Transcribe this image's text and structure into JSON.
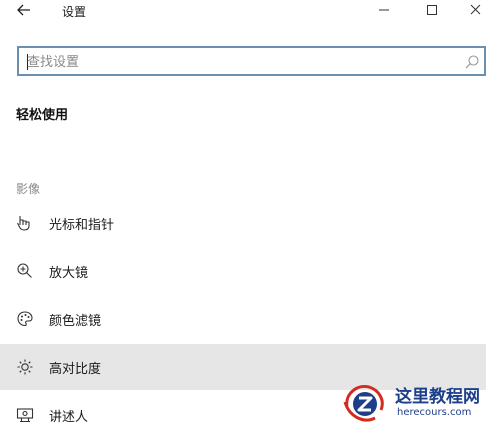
{
  "window": {
    "title": "设置"
  },
  "search": {
    "placeholder": "查找设置",
    "value": ""
  },
  "section": {
    "title": "轻松使用"
  },
  "group": {
    "label": "影像"
  },
  "nav_items": [
    {
      "label": "光标和指针",
      "icon": "pointer-hand-icon"
    },
    {
      "label": "放大镜",
      "icon": "magnifier-icon"
    },
    {
      "label": "颜色滤镜",
      "icon": "color-palette-icon"
    },
    {
      "label": "高对比度",
      "icon": "brightness-icon",
      "selected": true
    },
    {
      "label": "讲述人",
      "icon": "narrator-icon"
    }
  ],
  "watermark": {
    "title": "这里教程网",
    "subtitle": "herecours.com"
  },
  "colors": {
    "search_border": "#6a8fb0",
    "selected_bg": "#e6e6e6",
    "watermark_blue": "#1d3f8a",
    "watermark_red": "#d42a1f"
  }
}
